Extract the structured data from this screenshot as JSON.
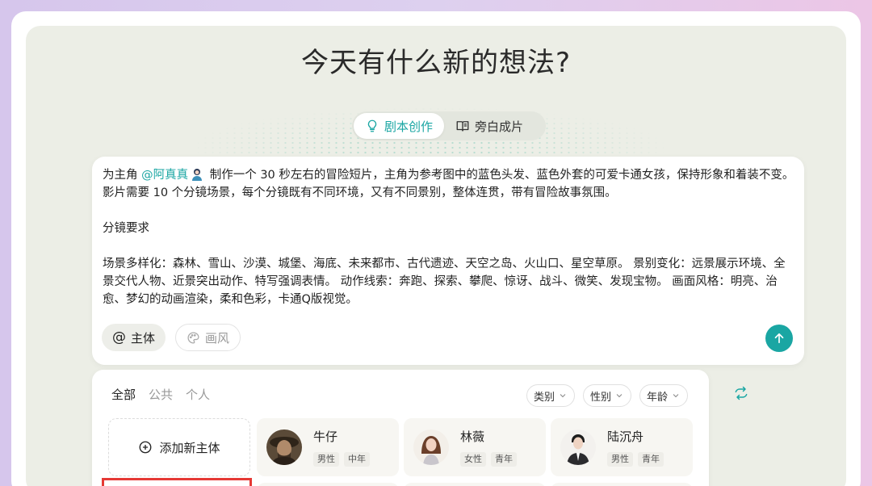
{
  "page": {
    "title": "今天有什么新的想法?"
  },
  "mode_tabs": [
    {
      "label": "剧本创作",
      "icon": "lightbulb-icon",
      "active": true
    },
    {
      "label": "旁白成片",
      "icon": "book-icon",
      "active": false
    }
  ],
  "prompt": {
    "line1_prefix": "为主角 ",
    "mention": "@阿真真",
    "line1_suffix": " 制作一个 30 秒左右的冒险短片，主角为参考图中的蓝色头发、蓝色外套的可爱卡通女孩，保持形象和着装不变。影片需要 10 个分镜场景，每个分镜既有不同环境，又有不同景别，整体连贯，带有冒险故事氛围。",
    "section_heading": "分镜要求",
    "requirements": "场景多样化：森林、雪山、沙漠、城堡、海底、未来都市、古代遗迹、天空之岛、火山口、星空草原。 景别变化：远景展示环境、全景交代人物、近景突出动作、特写强调表情。 动作线索：奔跑、探索、攀爬、惊讶、战斗、微笑、发现宝物。 画面风格：明亮、治愈、梦幻的动画渲染，柔和色彩，卡通Q版视觉。"
  },
  "chips": {
    "subject_label": "主体",
    "style_label": "画风"
  },
  "subject_panel": {
    "tabs": [
      {
        "label": "全部",
        "active": true
      },
      {
        "label": "公共",
        "active": false
      },
      {
        "label": "个人",
        "active": false
      }
    ],
    "filters": [
      "类别",
      "性别",
      "年龄"
    ],
    "add_label": "添加新主体",
    "characters": [
      {
        "name": "牛仔",
        "tags": [
          "男性",
          "中年"
        ]
      },
      {
        "name": "林薇",
        "tags": [
          "女性",
          "青年"
        ]
      },
      {
        "name": "陆沉舟",
        "tags": [
          "男性",
          "青年"
        ]
      }
    ]
  },
  "colors": {
    "accent": "#1aa6a3",
    "highlight_box": "#e53935",
    "canvas_bg": "#eceee6"
  }
}
